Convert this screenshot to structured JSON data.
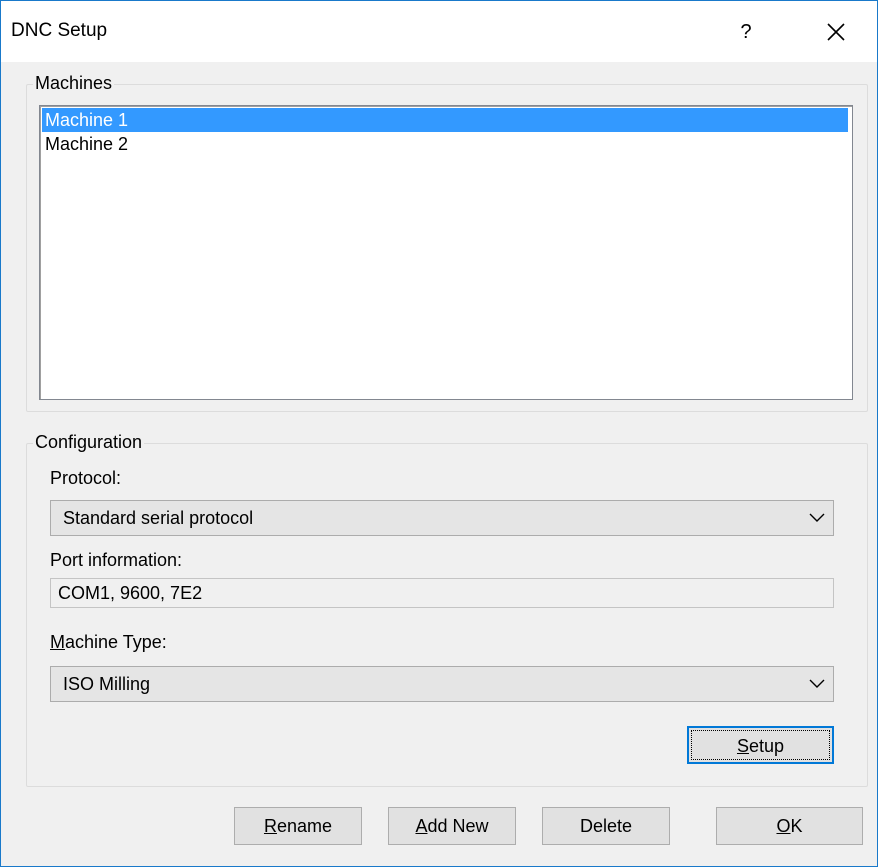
{
  "window": {
    "title": "DNC Setup",
    "help_label": "?",
    "close_icon": "close-icon"
  },
  "machines": {
    "group_label": "Machines",
    "items": [
      {
        "label": "Machine 1",
        "selected": true
      },
      {
        "label": "Machine 2",
        "selected": false
      }
    ]
  },
  "configuration": {
    "group_label": "Configuration",
    "protocol_label": "Protocol:",
    "protocol_value": "Standard serial protocol",
    "port_label": "Port information:",
    "port_value": "COM1, 9600, 7E2",
    "machine_type_label_accel": "M",
    "machine_type_label_rest": "achine Type:",
    "machine_type_value": "ISO Milling",
    "setup_accel": "S",
    "setup_rest": "etup"
  },
  "buttons": {
    "rename_accel": "R",
    "rename_rest": "ename",
    "add_new_accel": "A",
    "add_new_rest": "dd New",
    "delete_label": "Delete",
    "ok_accel": "O",
    "ok_rest": "K"
  },
  "colors": {
    "selection": "#3399ff",
    "focus_border": "#0078d7",
    "window_border": "#1979ca",
    "dialog_bg": "#f0f0f0"
  }
}
